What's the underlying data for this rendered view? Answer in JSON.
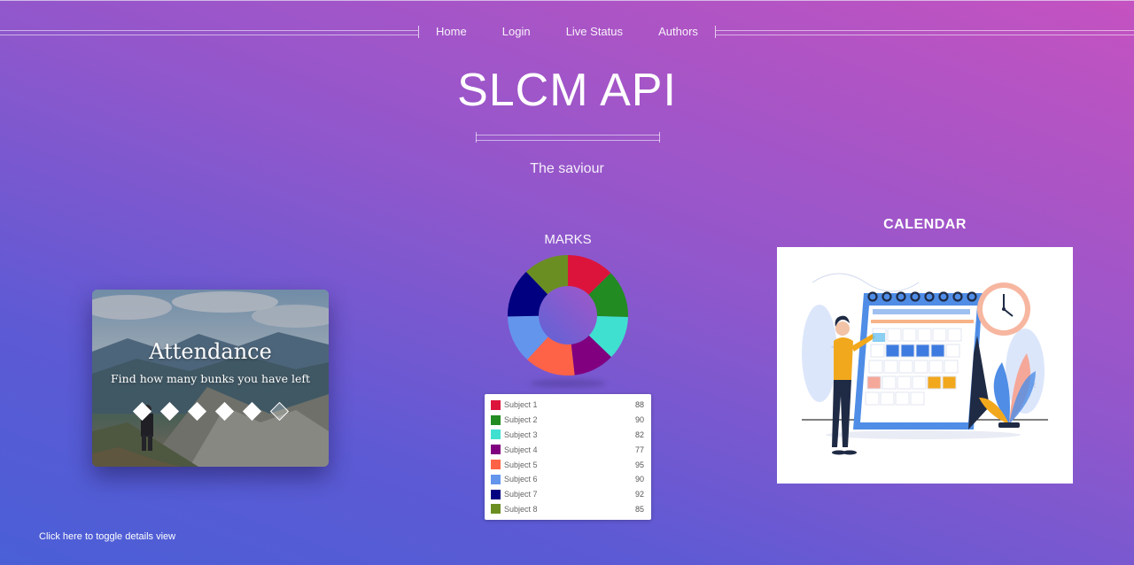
{
  "nav": {
    "items": [
      {
        "label": "Home"
      },
      {
        "label": "Login"
      },
      {
        "label": "Live Status"
      },
      {
        "label": "Authors"
      }
    ]
  },
  "hero": {
    "title": "SLCM API",
    "tagline": "The saviour"
  },
  "attendance": {
    "title": "Attendance",
    "subtitle": "Find how many bunks you have left",
    "indicators": 6
  },
  "marks": {
    "title": "MARKS",
    "legend": [
      {
        "name": "Subject 1",
        "value": "88"
      },
      {
        "name": "Subject 2",
        "value": "90"
      },
      {
        "name": "Subject 3",
        "value": "82"
      },
      {
        "name": "Subject 4",
        "value": "77"
      },
      {
        "name": "Subject 5",
        "value": "95"
      },
      {
        "name": "Subject 6",
        "value": "90"
      },
      {
        "name": "Subject 7",
        "value": "92"
      },
      {
        "name": "Subject 8",
        "value": "85"
      }
    ]
  },
  "chart_data": {
    "type": "pie",
    "categories": [
      "Subject 1",
      "Subject 2",
      "Subject 3",
      "Subject 4",
      "Subject 5",
      "Subject 6",
      "Subject 7",
      "Subject 8"
    ],
    "values": [
      88,
      90,
      82,
      77,
      95,
      90,
      92,
      85
    ],
    "colors": [
      "#dc143c",
      "#228b22",
      "#40e0d0",
      "#800080",
      "#ff6347",
      "#6495ed",
      "#000080",
      "#6b8e23"
    ],
    "title": "MARKS",
    "donut": true,
    "legend": "bottom"
  },
  "calendar": {
    "title": "CALENDAR",
    "illustration_icon": "calendar-illustration"
  },
  "footer": {
    "toggle_label": "Click here to toggle details view"
  }
}
